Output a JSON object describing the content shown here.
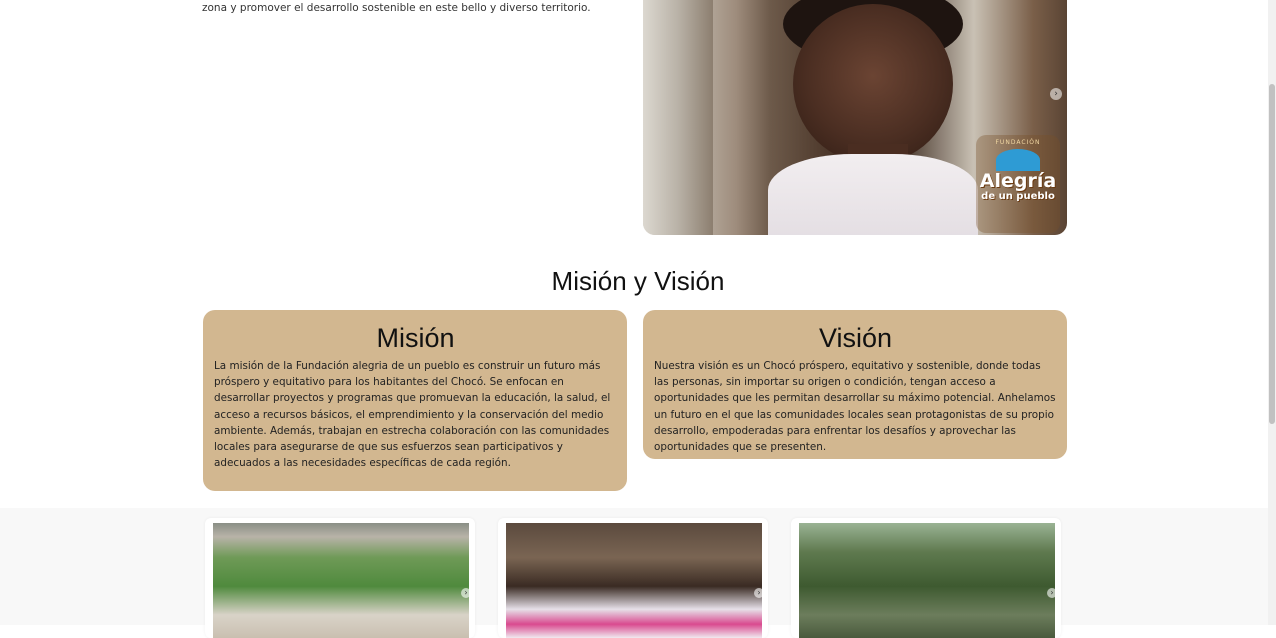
{
  "intro": {
    "text": "zona y promover el desarrollo sostenible en este bello y diverso territorio."
  },
  "hero": {
    "logo_top": "FUNDACIÓN",
    "logo_main": "Alegría",
    "logo_sub": "de un pueblo",
    "next_icon": "chevron-right-icon"
  },
  "section": {
    "title": "Misión y Visión"
  },
  "mision": {
    "title": "Misión",
    "text": "La misión de la Fundación alegria de un pueblo es construir un futuro más próspero y equitativo para los habitantes del Chocó. Se enfocan en desarrollar proyectos y programas que promuevan la educación, la salud, el acceso a recursos básicos, el emprendimiento y la conservación del medio ambiente. Además, trabajan en estrecha colaboración con las comunidades locales para asegurarse de que sus esfuerzos sean participativos y adecuados a las necesidades específicas de cada región."
  },
  "vision": {
    "title": "Visión",
    "text": "Nuestra visión es un Chocó próspero, equitativo y sostenible, donde todas las personas, sin importar su origen o condición, tengan acceso a oportunidades que les permitan desarrollar su máximo potencial. Anhelamos un futuro en el que las comunidades locales sean protagonistas de su propio desarrollo, empoderadas para enfrentar los desafíos y aprovechar las oportunidades que se presenten."
  },
  "colors": {
    "card_bg": "#d2b790",
    "gallery_bg": "#f8f8f8"
  }
}
